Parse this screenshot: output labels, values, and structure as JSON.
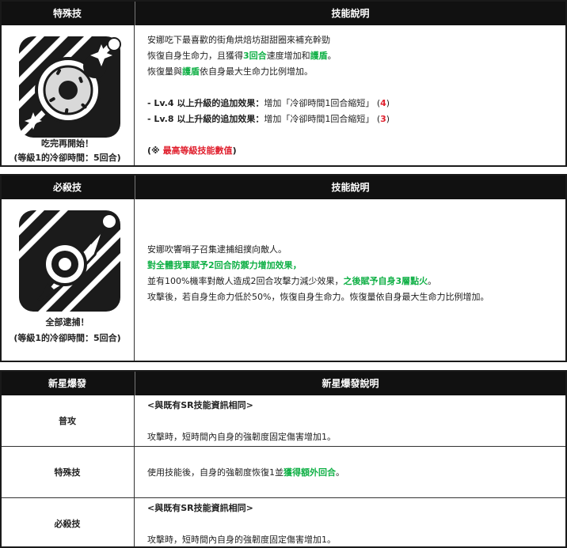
{
  "table1": {
    "header_left": "特殊技",
    "header_right": "技能說明",
    "skill_name": "吃完再開始！",
    "cooldown": "(等級1的冷卻時間：5回合)",
    "line1": "安娜吃下最喜歡的街角烘焙坊甜甜圈來補充幹勁",
    "line2_a": "恢復自身生命力，且獲得",
    "line2_b": "3回合",
    "line2_c": "速度增加和",
    "line2_d": "護盾",
    "line2_e": "。",
    "line3_a": "恢復量與",
    "line3_b": "護盾",
    "line3_c": "依自身最大生命力比例增加。",
    "lv4_a": "- Lv.4 以上升級的追加效果：",
    "lv4_b": "增加「冷卻時間1回合縮短」 (",
    "lv4_c": "4",
    "lv4_d": ")",
    "lv8_a": "- Lv.8 以上升級的追加效果：",
    "lv8_b": "增加「冷卻時間1回合縮短」 (",
    "lv8_c": "3",
    "lv8_d": ")",
    "note_a": "(※ ",
    "note_b": "最高等級技能數值",
    "note_c": ")"
  },
  "table2": {
    "header_left": "必殺技",
    "header_right": "技能說明",
    "skill_name": "全部逮捕！",
    "cooldown": "(等級1的冷卻時間：5回合)",
    "line1": "安娜吹響哨子召集逮捕組撲向敵人。",
    "line2": "對全體我軍賦予2回合防禦力增加效果，",
    "line3_a": "並有100%機率對敵人造成2回合攻擊力減少效果，",
    "line3_b": "之後賦予自身3層點火",
    "line3_c": "。",
    "line4": "攻擊後，若自身生命力低於50%，恢復自身生命力。恢復量依自身最大生命力比例增加。"
  },
  "table3": {
    "header_left": "新星爆發",
    "header_right": "新星爆發說明",
    "rows": [
      {
        "label": "普攻",
        "note": "<與既有SR技能資訊相同>",
        "text": "攻擊時，短時間內自身的強韌度固定傷害增加1。"
      },
      {
        "label": "特殊技",
        "text_a": "使用技能後，自身的強韌度恢復1並",
        "text_b": "獲得額外回合",
        "text_c": "。"
      },
      {
        "label": "必殺技",
        "note": "<與既有SR技能資訊相同>",
        "text": "攻擊時，短時間內自身的強韌度固定傷害增加1。"
      }
    ]
  },
  "colors": {
    "green": "#10b046",
    "red": "#e0202e",
    "header_bg": "#111111"
  },
  "icons": [
    "donut-skill-icon",
    "whistle-skill-icon"
  ]
}
